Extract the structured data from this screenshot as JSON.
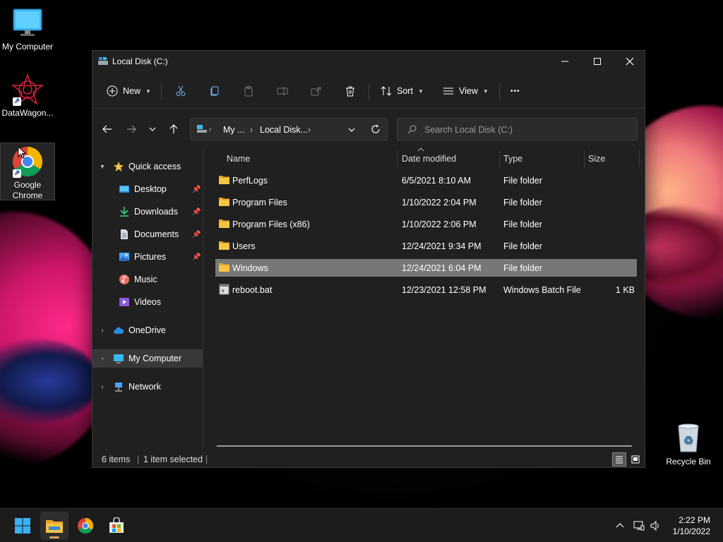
{
  "desktop": {
    "icons": [
      {
        "label": "My Computer"
      },
      {
        "label": "DataWagon..."
      },
      {
        "label": "Google Chrome"
      },
      {
        "label": "Recycle Bin"
      }
    ]
  },
  "window": {
    "title": "Local Disk (C:)",
    "toolbar": {
      "new_label": "New",
      "sort_label": "Sort",
      "view_label": "View",
      "more_label": "•••"
    },
    "address": {
      "crumbs": [
        "My ...",
        "Local Disk..."
      ]
    },
    "search": {
      "placeholder": "Search Local Disk (C:)"
    },
    "nav": {
      "quick_access": "Quick access",
      "items": [
        {
          "label": "Desktop"
        },
        {
          "label": "Downloads"
        },
        {
          "label": "Documents"
        },
        {
          "label": "Pictures"
        },
        {
          "label": "Music"
        },
        {
          "label": "Videos"
        }
      ],
      "onedrive": "OneDrive",
      "my_computer": "My Computer",
      "network": "Network"
    },
    "columns": {
      "name": "Name",
      "date": "Date modified",
      "type": "Type",
      "size": "Size"
    },
    "files": [
      {
        "name": "PerfLogs",
        "date": "6/5/2021 8:10 AM",
        "type": "File folder",
        "size": ""
      },
      {
        "name": "Program Files",
        "date": "1/10/2022 2:04 PM",
        "type": "File folder",
        "size": ""
      },
      {
        "name": "Program Files (x86)",
        "date": "1/10/2022 2:06 PM",
        "type": "File folder",
        "size": ""
      },
      {
        "name": "Users",
        "date": "12/24/2021 9:34 PM",
        "type": "File folder",
        "size": ""
      },
      {
        "name": "Windows",
        "date": "12/24/2021 6:04 PM",
        "type": "File folder",
        "size": ""
      },
      {
        "name": "reboot.bat",
        "date": "12/23/2021 12:58 PM",
        "type": "Windows Batch File",
        "size": "1 KB"
      }
    ],
    "status": {
      "count": "6 items",
      "selected": "1 item selected"
    }
  },
  "taskbar": {
    "time": "2:22 PM",
    "date": "1/10/2022"
  },
  "colors": {
    "window_bg": "#202020",
    "folder_yellow": "#f5c542",
    "accent_blue": "#4aa3ff",
    "selection": "#777777"
  }
}
